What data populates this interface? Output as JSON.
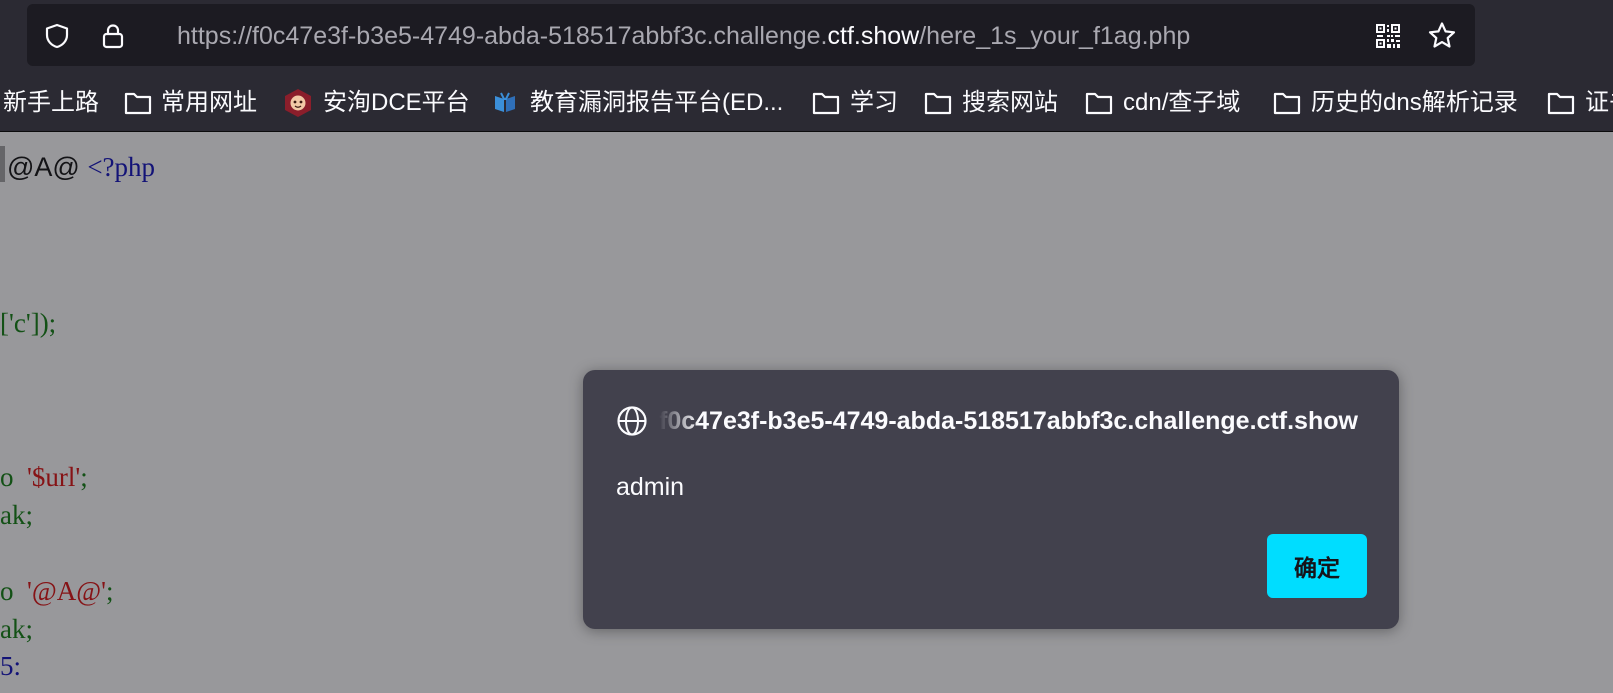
{
  "browser": {
    "url_prefix": "https://f0c47e3f-b3e5-4749-abda-518517abbf3c.challenge.",
    "url_host": "ctf.show",
    "url_suffix": "/here_1s_your_f1ag.php",
    "icons": [
      "shield-icon",
      "lock-icon",
      "qr-code-icon",
      "bookmark-star-icon"
    ]
  },
  "bookmarks": [
    {
      "label": "新手上路",
      "icon": "none"
    },
    {
      "label": "常用网址",
      "icon": "folder-icon"
    },
    {
      "label": "安洵DCE平台",
      "icon": "monkey-logo-icon"
    },
    {
      "label": "教育漏洞报告平台(ED...",
      "icon": "book-logo-icon"
    },
    {
      "label": "学习",
      "icon": "folder-icon"
    },
    {
      "label": "搜索网站",
      "icon": "folder-icon"
    },
    {
      "label": "cdn/查子域",
      "icon": "folder-icon"
    },
    {
      "label": "历史的dns解析记录",
      "icon": "folder-icon"
    },
    {
      "label": "证书",
      "icon": "folder-icon"
    }
  ],
  "page": {
    "line1_prefix": "@A@ ",
    "line1_php": "<?php",
    "line2": "['c']);",
    "line3_prefix": "o  ",
    "line3_string": "'$url'",
    "line3_end": ";",
    "line4": "ak;",
    "line5_prefix": "o  ",
    "line5_string": "'@A@'",
    "line5_end": ";",
    "line6": "ak;",
    "line7": "5:"
  },
  "dialog": {
    "origin": "f0c47e3f-b3e5-4749-abda-518517abbf3c.challenge.ctf.show",
    "message": "admin",
    "ok_label": "确定",
    "accent_color": "#00ddff",
    "background_color": "#42414d"
  }
}
